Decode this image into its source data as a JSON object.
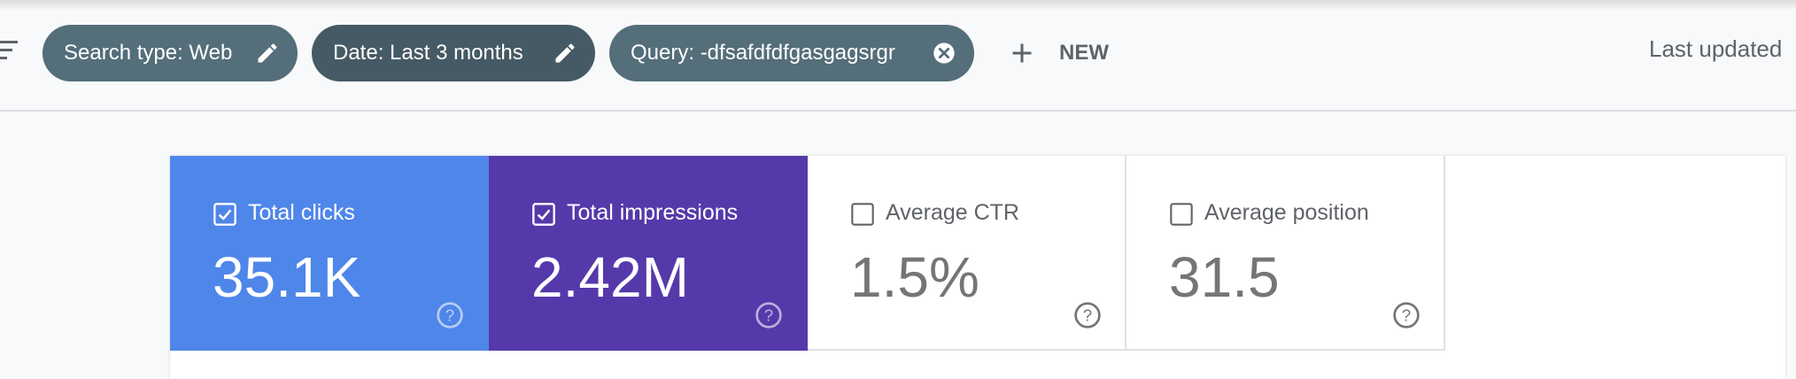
{
  "colors": {
    "background": "#f8f9fa",
    "chip_light": "#546e7a",
    "chip_dark": "#455a64",
    "clicks_card": "#4f86e9",
    "impressions_card": "#5539aa",
    "inactive_label": "#5f6368",
    "inactive_value": "#757575"
  },
  "filters": {
    "sort_icon": "filter-list-icon",
    "chips": [
      {
        "label": "Search type: Web",
        "icon": "edit-icon"
      },
      {
        "label": "Date: Last 3 months",
        "icon": "edit-icon"
      },
      {
        "label": "Query: -dfsafdfdfgasgagsrgr",
        "icon": "close-circle-icon"
      }
    ],
    "new_button": {
      "label": "NEW",
      "icon": "plus-icon"
    },
    "last_updated": "Last updated"
  },
  "metrics": [
    {
      "label": "Total clicks",
      "value": "35.1K",
      "checked": true,
      "color": "#4f86e9",
      "help_icon": "help-icon"
    },
    {
      "label": "Total impressions",
      "value": "2.42M",
      "checked": true,
      "color": "#5539aa",
      "help_icon": "help-icon"
    },
    {
      "label": "Average CTR",
      "value": "1.5%",
      "checked": false,
      "color": "#ffffff",
      "help_icon": "help-icon"
    },
    {
      "label": "Average position",
      "value": "31.5",
      "checked": false,
      "color": "#ffffff",
      "help_icon": "help-icon"
    }
  ]
}
